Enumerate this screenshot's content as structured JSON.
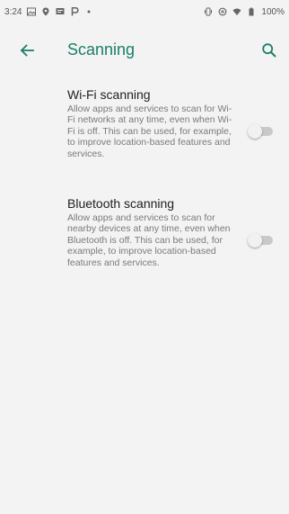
{
  "status_bar": {
    "time": "3:24",
    "battery_text": "100%",
    "left_icons": [
      "image-icon",
      "location-pin-icon",
      "message-icon",
      "p-icon",
      "dot-icon"
    ],
    "right_icons": [
      "vibrate-icon",
      "data-saver-icon",
      "wifi-icon",
      "battery-icon"
    ]
  },
  "app_bar": {
    "title": "Scanning",
    "back_icon": "arrow-back-icon",
    "search_icon": "search-icon",
    "accent_color": "#1a7f68"
  },
  "settings": {
    "items": [
      {
        "title": "Wi-Fi scanning",
        "summary": "Allow apps and services to scan for Wi-Fi networks at any time, even when Wi-Fi is off. This can be used, for example, to improve location-based features and services.",
        "toggle_on": false
      },
      {
        "title": "Bluetooth scanning",
        "summary": "Allow apps and services to scan for nearby devices at any time, even when Bluetooth is off. This can be used, for example, to improve location-based features and services.",
        "toggle_on": false
      }
    ]
  }
}
